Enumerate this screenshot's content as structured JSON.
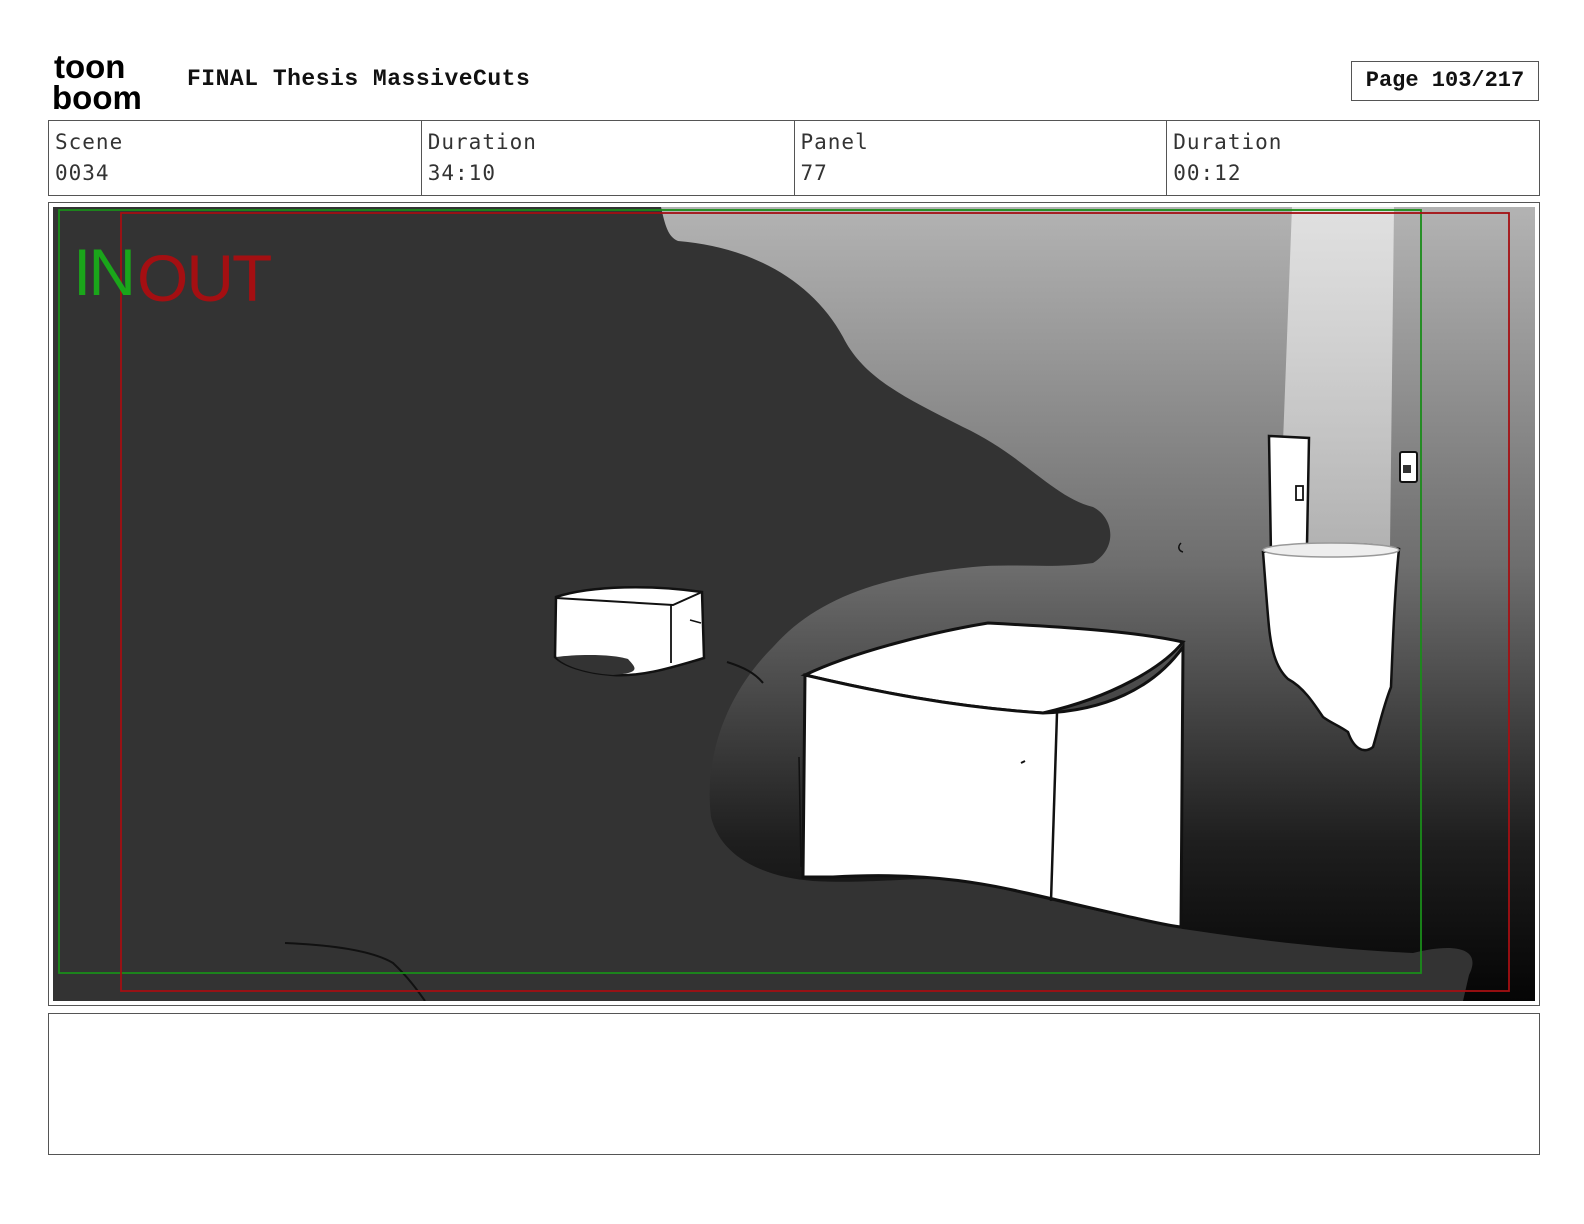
{
  "header": {
    "logo_top": "toon",
    "logo_bottom": "boom",
    "title": "FINAL Thesis MassiveCuts",
    "page": "Page 103/217"
  },
  "info": [
    {
      "label": "Scene",
      "value": "0034"
    },
    {
      "label": "Duration",
      "value": "34:10"
    },
    {
      "label": "Panel",
      "value": "77"
    },
    {
      "label": "Duration",
      "value": "00:12"
    }
  ],
  "panel": {
    "in_label": "IN",
    "out_label": "OUT",
    "in_color": "#1aa61a",
    "out_color": "#a40f12",
    "dark_fill": "#333333"
  },
  "notes": {
    "text": ""
  }
}
